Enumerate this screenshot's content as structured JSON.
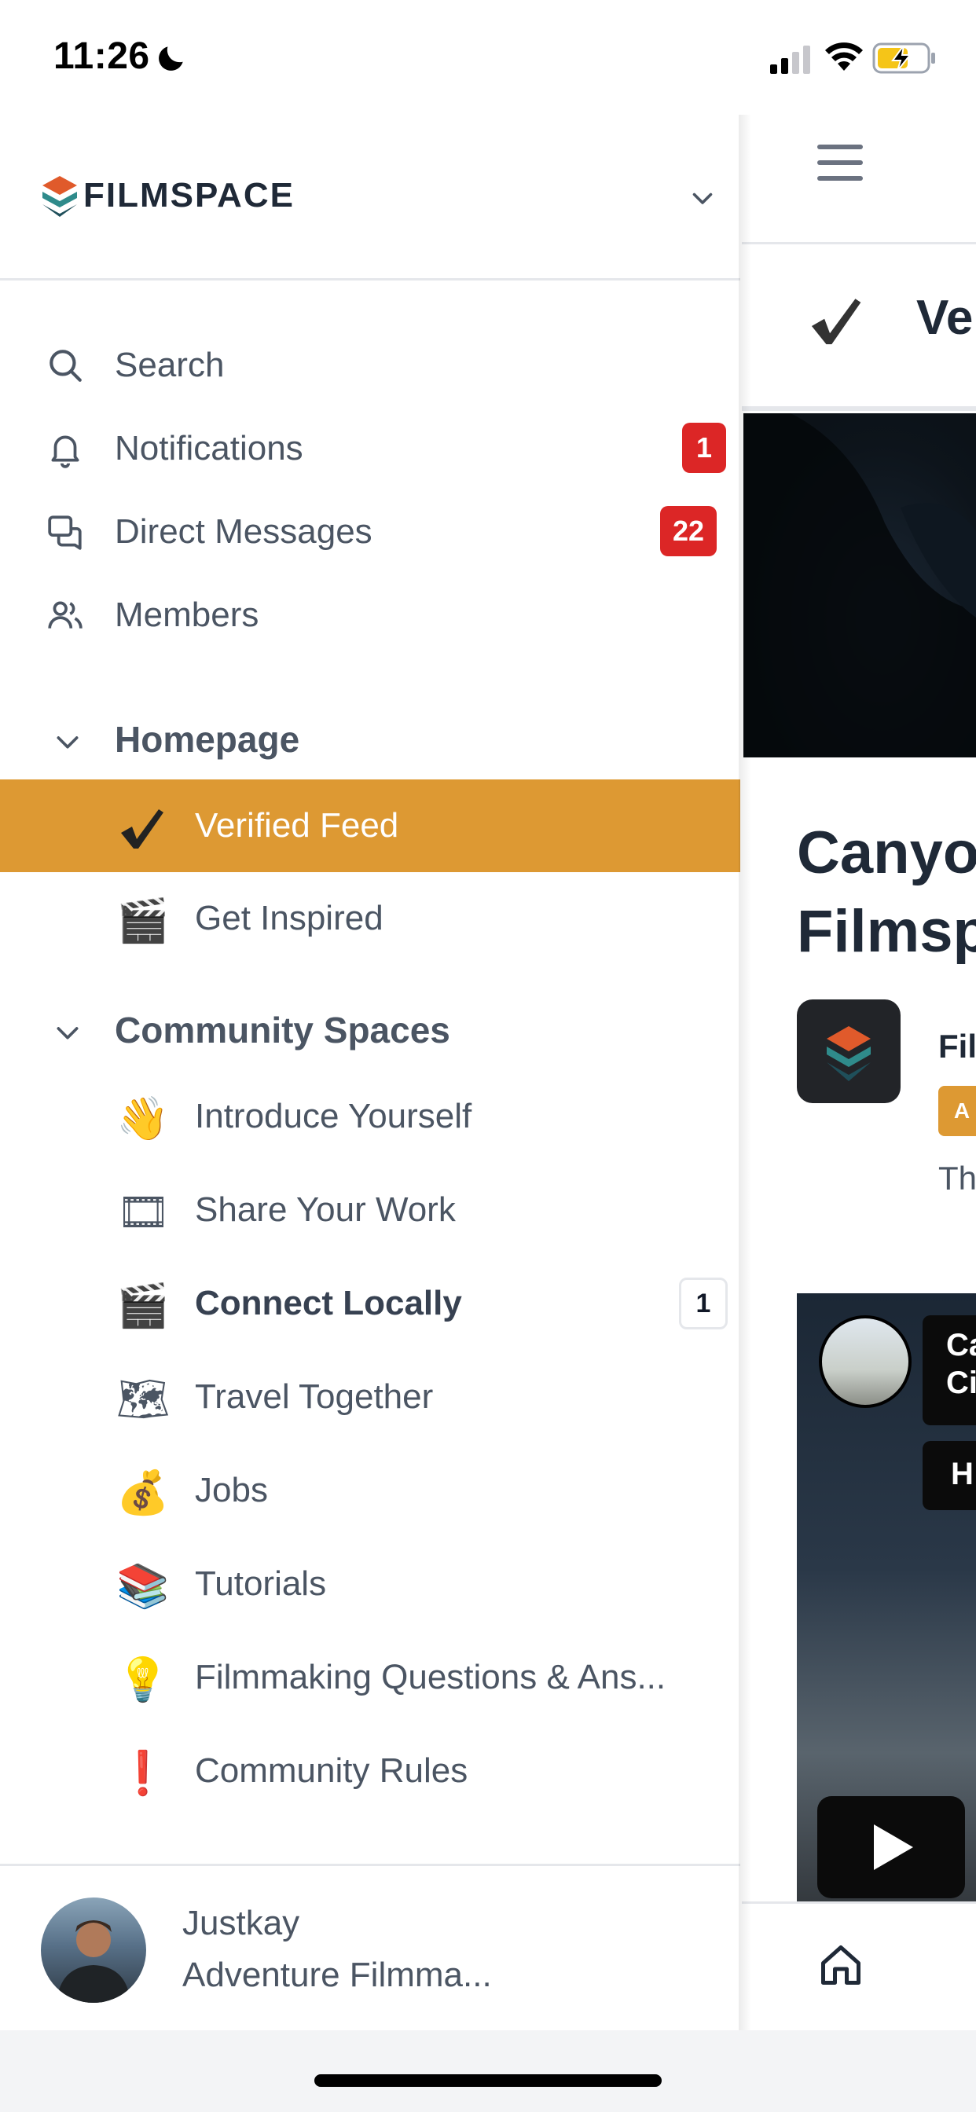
{
  "status_bar": {
    "time": "11:26"
  },
  "brand": {
    "name": "FILMSPACE",
    "colors": {
      "accent": "#dd9933",
      "badge_red": "#dc2626",
      "logo_orange": "#e05a2b",
      "logo_teal": "#2f8b8b"
    }
  },
  "nav": {
    "items": [
      {
        "label": "Search",
        "icon": "search-icon"
      },
      {
        "label": "Notifications",
        "icon": "bell-icon",
        "badge": "1"
      },
      {
        "label": "Direct Messages",
        "icon": "messages-icon",
        "badge": "22"
      },
      {
        "label": "Members",
        "icon": "members-icon"
      }
    ]
  },
  "sections": [
    {
      "title": "Homepage",
      "items": [
        {
          "emoji": "✔",
          "label": "Verified Feed",
          "active": true
        },
        {
          "emoji": "🎬",
          "label": "Get Inspired"
        }
      ]
    },
    {
      "title": "Community Spaces",
      "items": [
        {
          "emoji": "👋",
          "label": "Introduce Yourself"
        },
        {
          "emoji": "🎞",
          "label": "Share Your Work"
        },
        {
          "emoji": "🎬",
          "label": "Connect Locally",
          "unread": "1"
        },
        {
          "emoji": "🗺",
          "label": "Travel Together"
        },
        {
          "emoji": "💰",
          "label": "Jobs"
        },
        {
          "emoji": "📚",
          "label": "Tutorials"
        },
        {
          "emoji": "💡",
          "label": "Filmmaking Questions & Ans..."
        },
        {
          "emoji": "❗",
          "label": "Community Rules"
        }
      ]
    }
  ],
  "user": {
    "name": "Justkay",
    "title": "Adventure Filmma..."
  },
  "main": {
    "title": "Ve",
    "post_title_line1": "Canyo",
    "post_title_line2": "Filmsp",
    "author": "Fil",
    "role_badge": "A",
    "snippet": "Th",
    "video_title": "Ca\nCi",
    "video_subtitle": "H"
  }
}
